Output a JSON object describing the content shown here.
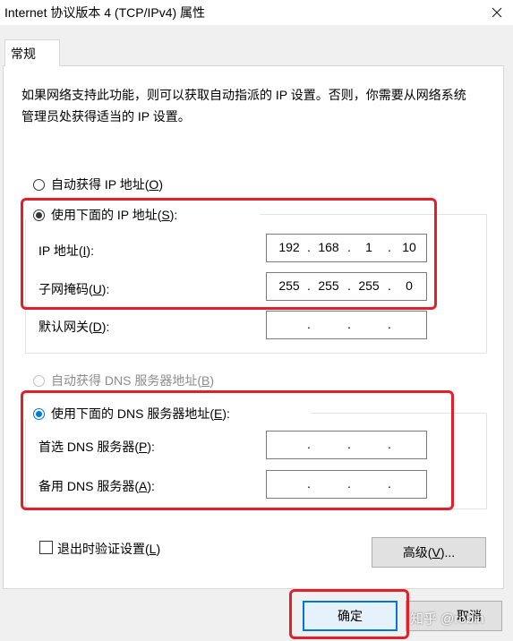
{
  "window": {
    "title": "Internet 协议版本 4 (TCP/IPv4) 属性",
    "close_icon": "close-icon"
  },
  "tabs": [
    {
      "label": "常规"
    }
  ],
  "description": "如果网络支持此功能，则可以获取自动指派的 IP 设置。否则，你需要从网络系统管理员处获得适当的 IP 设置。",
  "ip": {
    "auto_option": {
      "label": "自动获得 IP 地址(",
      "key": "O",
      "end": ")",
      "selected": false
    },
    "manual_option": {
      "label": "使用下面的 IP 地址(",
      "key": "S",
      "end": "):",
      "selected": true
    },
    "address": {
      "label": "IP 地址(",
      "key": "I",
      "end": "):",
      "octets": [
        "192",
        "168",
        "1",
        "10"
      ]
    },
    "subnet": {
      "label": "子网掩码(",
      "key": "U",
      "end": "):",
      "octets": [
        "255",
        "255",
        "255",
        "0"
      ]
    },
    "gateway": {
      "label": "默认网关(",
      "key": "D",
      "end": "):",
      "octets": [
        "",
        "",
        "",
        ""
      ]
    }
  },
  "dns": {
    "auto_option": {
      "label": "自动获得 DNS 服务器地址(",
      "key": "B",
      "end": ")",
      "selected": false,
      "disabled": true
    },
    "manual_option": {
      "label": "使用下面的 DNS 服务器地址(",
      "key": "E",
      "end": "):",
      "selected": true
    },
    "preferred": {
      "label": "首选 DNS 服务器(",
      "key": "P",
      "end": "):",
      "octets": [
        "",
        "",
        "",
        ""
      ]
    },
    "alternate": {
      "label": "备用 DNS 服务器(",
      "key": "A",
      "end": "):",
      "octets": [
        "",
        "",
        "",
        ""
      ]
    }
  },
  "validate_on_exit": {
    "label": "退出时验证设置(",
    "key": "L",
    "end": ")",
    "checked": false
  },
  "buttons": {
    "advanced": {
      "label": "高级(",
      "key": "V",
      "end": ")..."
    },
    "ok": {
      "label": "确定"
    },
    "cancel": {
      "label": "取消"
    }
  },
  "watermark": "知乎 @robin",
  "colors": {
    "highlight": "#e0202a",
    "accent": "#0078d7"
  }
}
